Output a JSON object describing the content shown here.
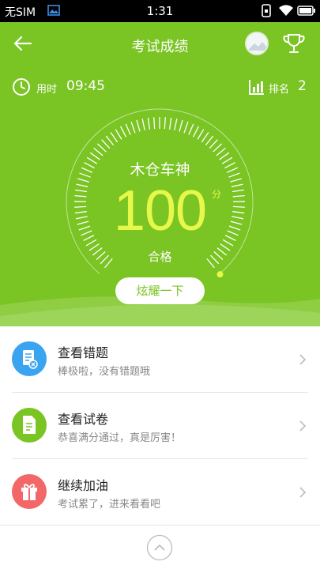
{
  "status_bar": {
    "carrier": "无SIM",
    "time": "1:31"
  },
  "header": {
    "title": "考试成绩"
  },
  "stats": {
    "time_label": "用时",
    "time_value": "09:45",
    "rank_label": "排名",
    "rank_value": "2"
  },
  "result": {
    "driver_name": "木仓车神",
    "score": "100",
    "score_unit": "分",
    "verdict": "合格",
    "share_button": "炫耀一下"
  },
  "actions": [
    {
      "title": "查看错题",
      "subtitle": "棒极啦，没有错题哦",
      "icon": "error-review-icon",
      "color": "#3aa4f0"
    },
    {
      "title": "查看试卷",
      "subtitle": "恭喜满分通过，真是厉害！",
      "icon": "document-icon",
      "color": "#7ac424"
    },
    {
      "title": "继续加油",
      "subtitle": "考试累了，进来看看吧",
      "icon": "gift-icon",
      "color": "#f26767"
    }
  ],
  "theme": {
    "primary": "#7ac424",
    "score_color": "#e8f84a"
  }
}
